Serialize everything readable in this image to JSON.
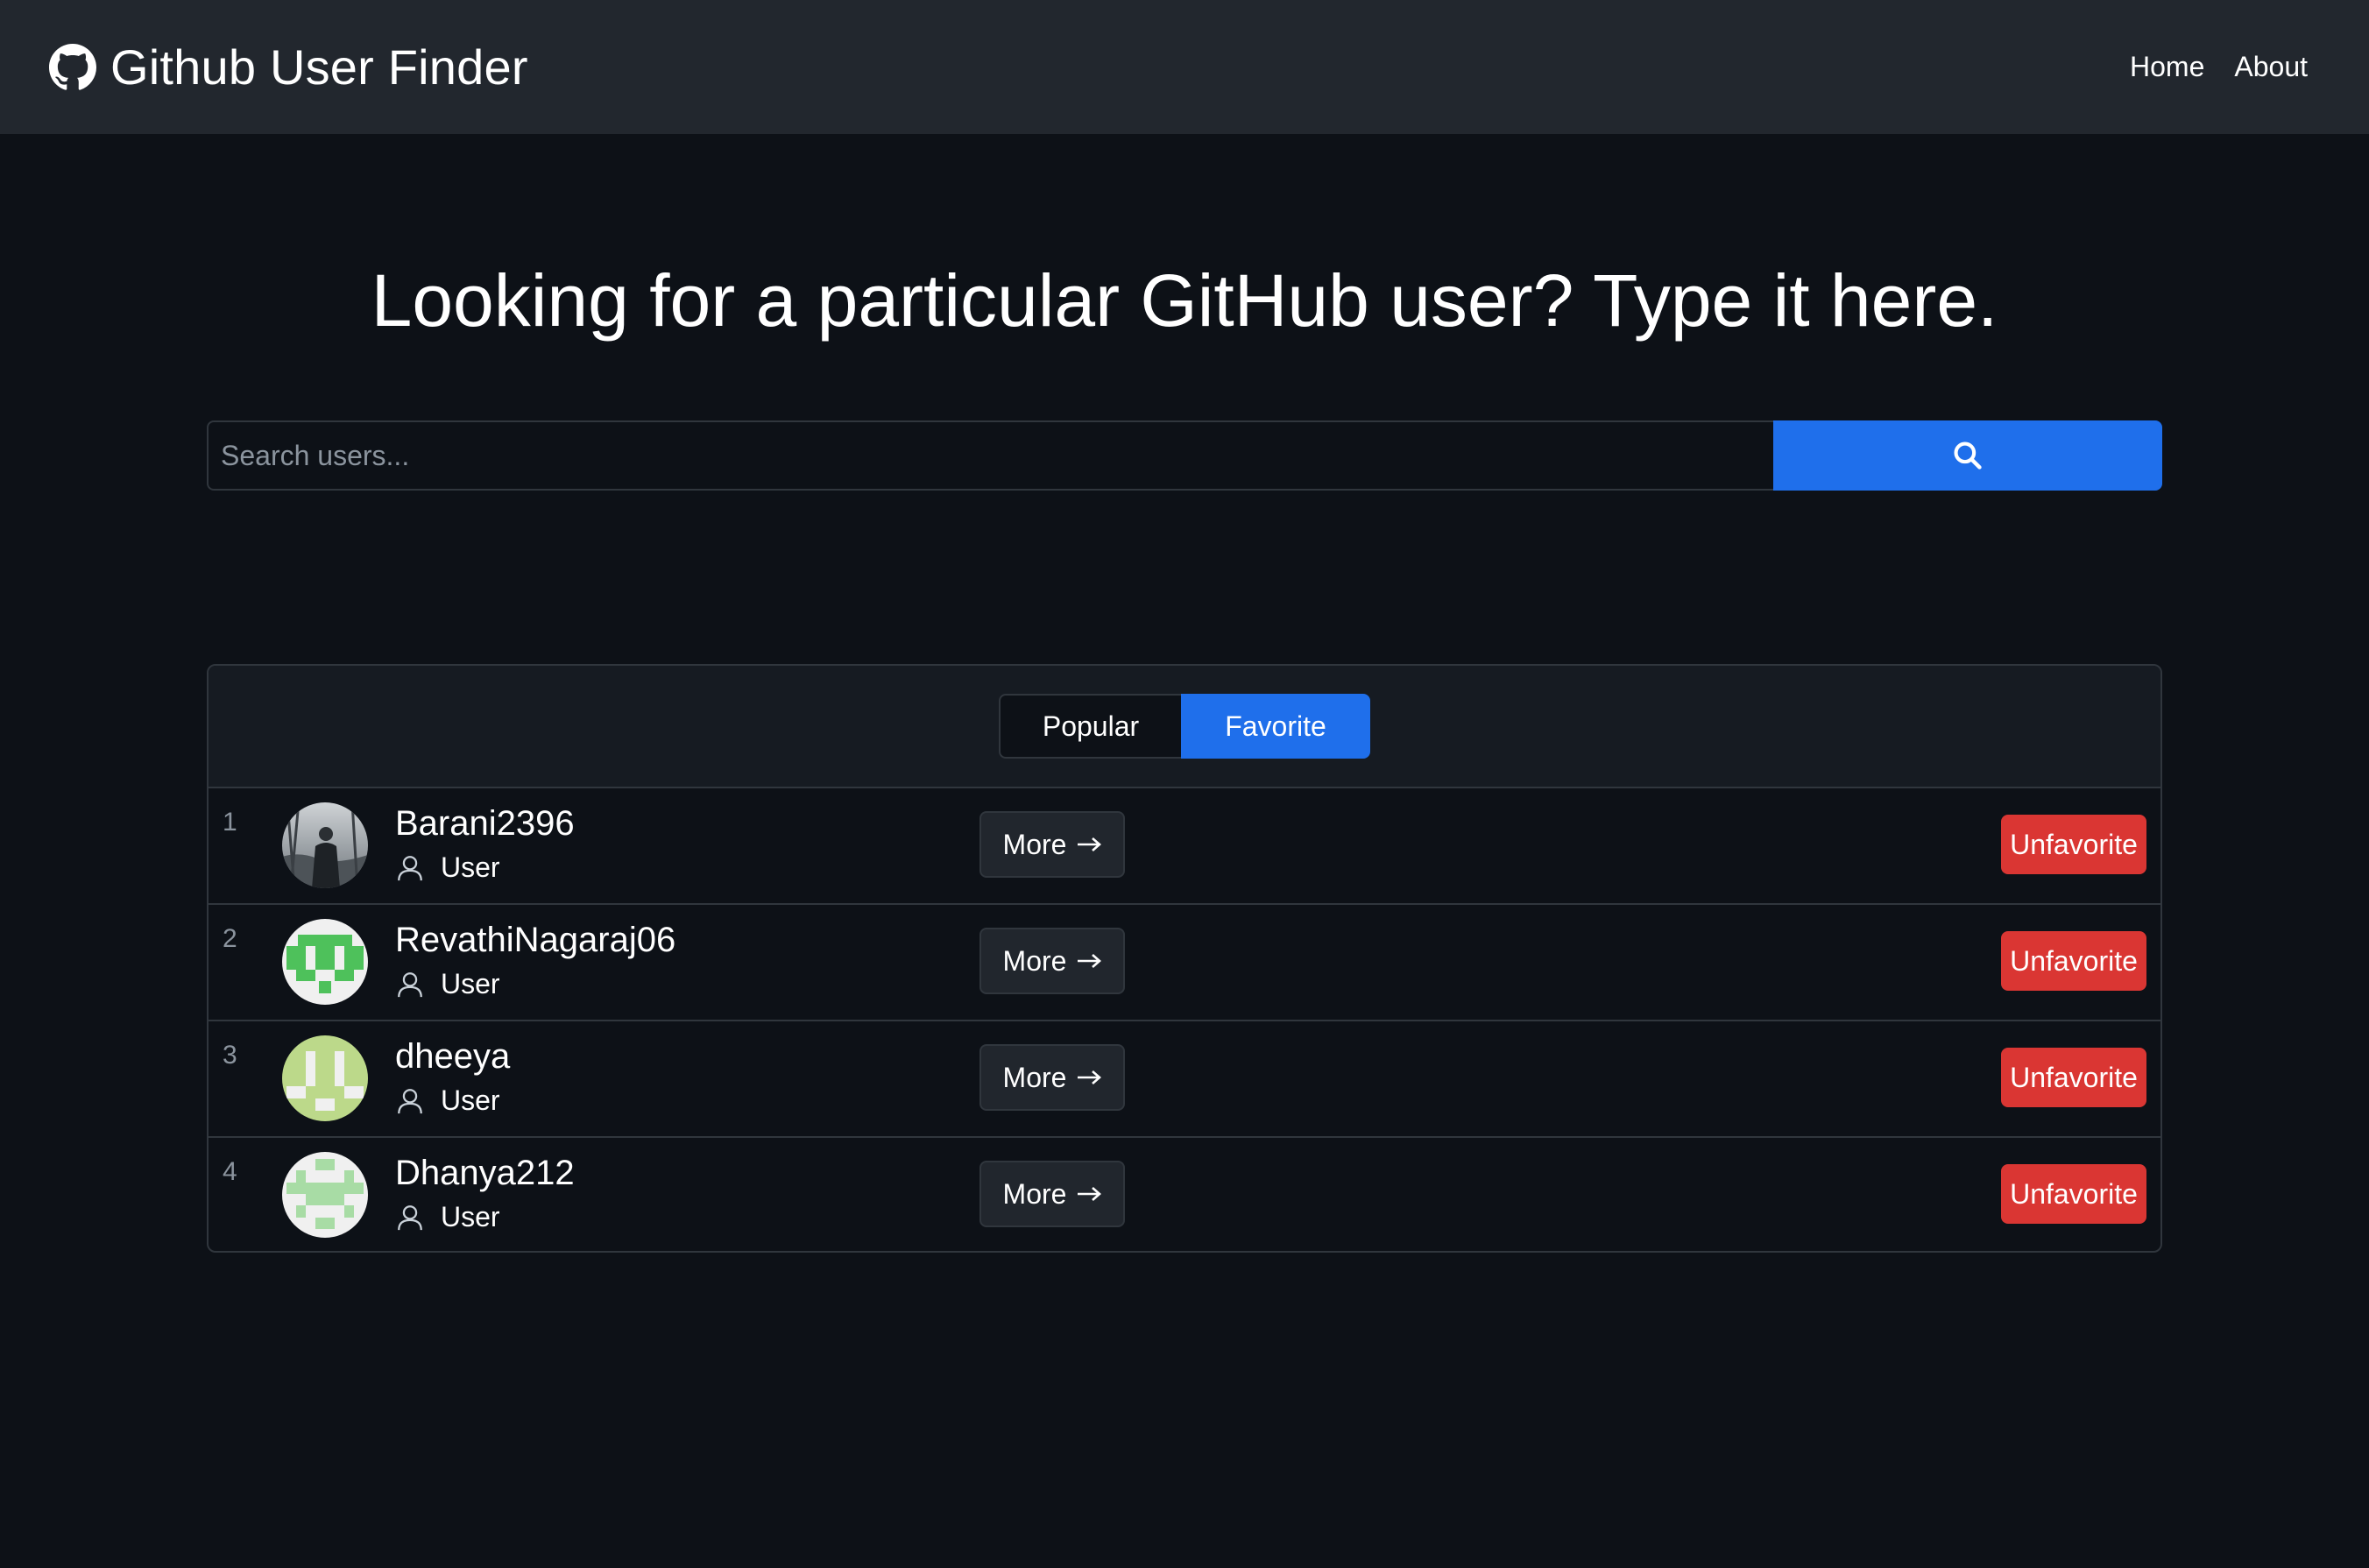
{
  "navbar": {
    "brand_icon": "github-icon",
    "title": "Github User Finder",
    "links": [
      "Home",
      "About"
    ]
  },
  "hero": {
    "title": "Looking for a particular GitHub user? Type it here."
  },
  "search": {
    "placeholder": "Search users...",
    "value": "",
    "button_icon": "search-icon"
  },
  "tabs": {
    "popular": "Popular",
    "favorite": "Favorite",
    "active": "favorite"
  },
  "users": [
    {
      "index": "1",
      "name": "Barani2396",
      "type": "User",
      "more": "More",
      "action": "Unfavorite"
    },
    {
      "index": "2",
      "name": "RevathiNagaraj06",
      "type": "User",
      "more": "More",
      "action": "Unfavorite"
    },
    {
      "index": "3",
      "name": "dheeya",
      "type": "User",
      "more": "More",
      "action": "Unfavorite"
    },
    {
      "index": "4",
      "name": "Dhanya212",
      "type": "User",
      "more": "More",
      "action": "Unfavorite"
    }
  ],
  "colors": {
    "background": "#0d1117",
    "navbar": "#22272e",
    "primary": "#1f6feb",
    "danger": "#da3633"
  }
}
